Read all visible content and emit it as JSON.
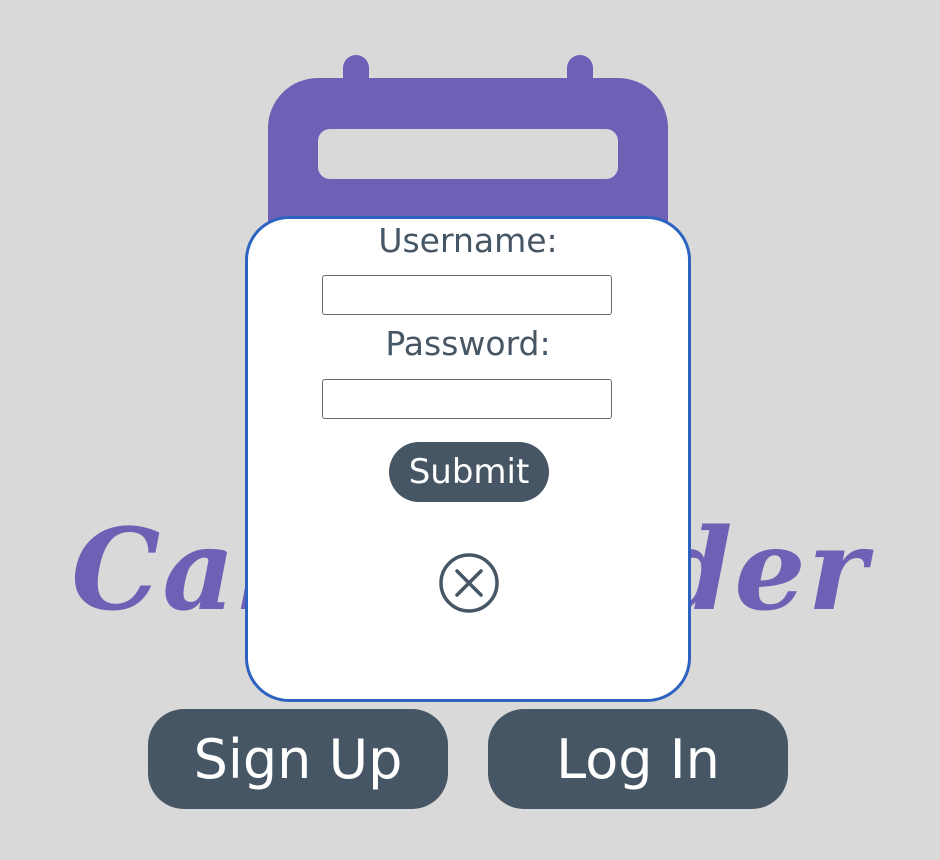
{
  "brand": {
    "name": "Calendarder",
    "color": "#6f5fb5"
  },
  "login_modal": {
    "username_label": "Username:",
    "username_value": "",
    "password_label": "Password:",
    "password_value": "",
    "submit_label": "Submit",
    "close_icon": "close-circle-icon",
    "border_color": "#2d62c0"
  },
  "actions": {
    "signup_label": "Sign Up",
    "login_label": "Log In",
    "button_color": "#465664"
  },
  "background_color": "#d9d9d9"
}
